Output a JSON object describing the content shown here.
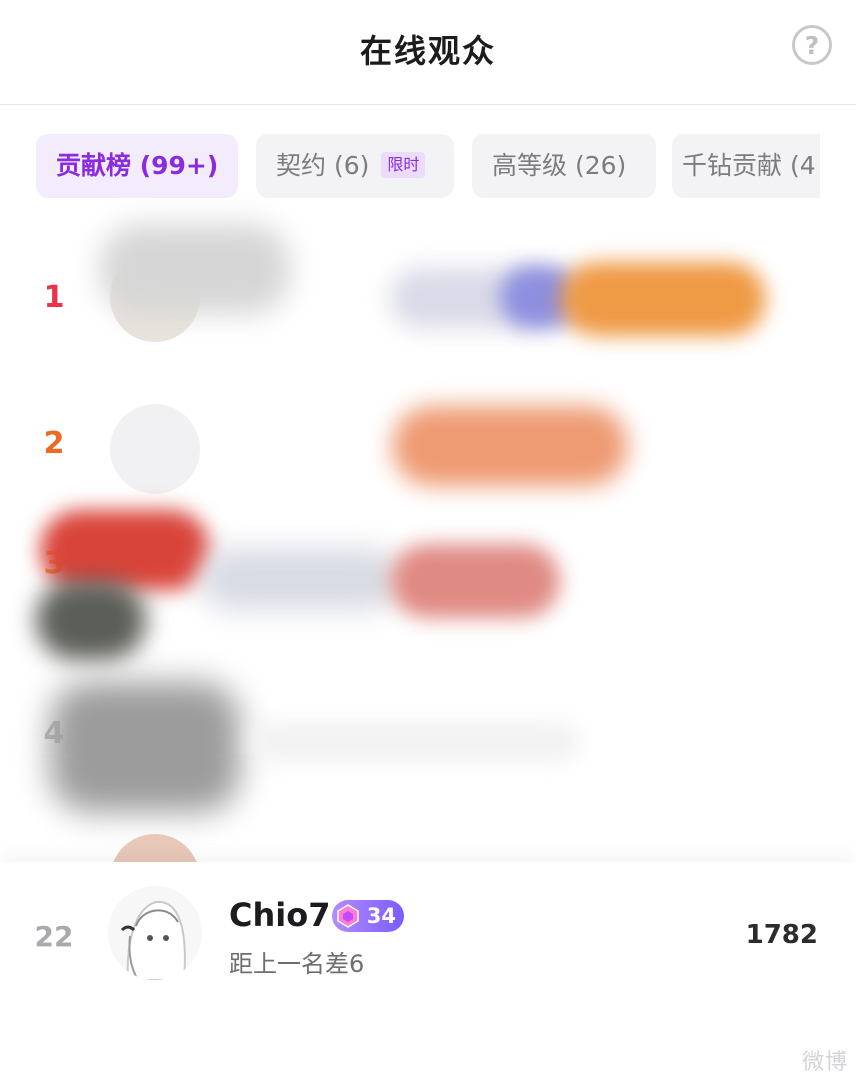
{
  "header": {
    "title": "在线观众",
    "help_symbol": "?"
  },
  "tabs": [
    {
      "label": "贡献榜 (99+)",
      "active": true
    },
    {
      "label": "契约 (6)",
      "badge": "限时",
      "active": false
    },
    {
      "label": "高等级 (26)",
      "active": false
    },
    {
      "label": "千钻贡献 (4",
      "active": false
    }
  ],
  "list": {
    "rows": [
      {
        "rank": "1",
        "rank_color": "#e8334a"
      },
      {
        "rank": "2",
        "rank_color": "#ee6a24"
      },
      {
        "rank": "3",
        "rank_color": "#f0a02a"
      },
      {
        "rank": "4",
        "rank_color": "#b8b8bc"
      }
    ]
  },
  "self": {
    "rank": "22",
    "name": "Chio7",
    "level": "34",
    "gap_text": "距上一名差6",
    "score": "1782"
  },
  "watermark": "微博"
}
